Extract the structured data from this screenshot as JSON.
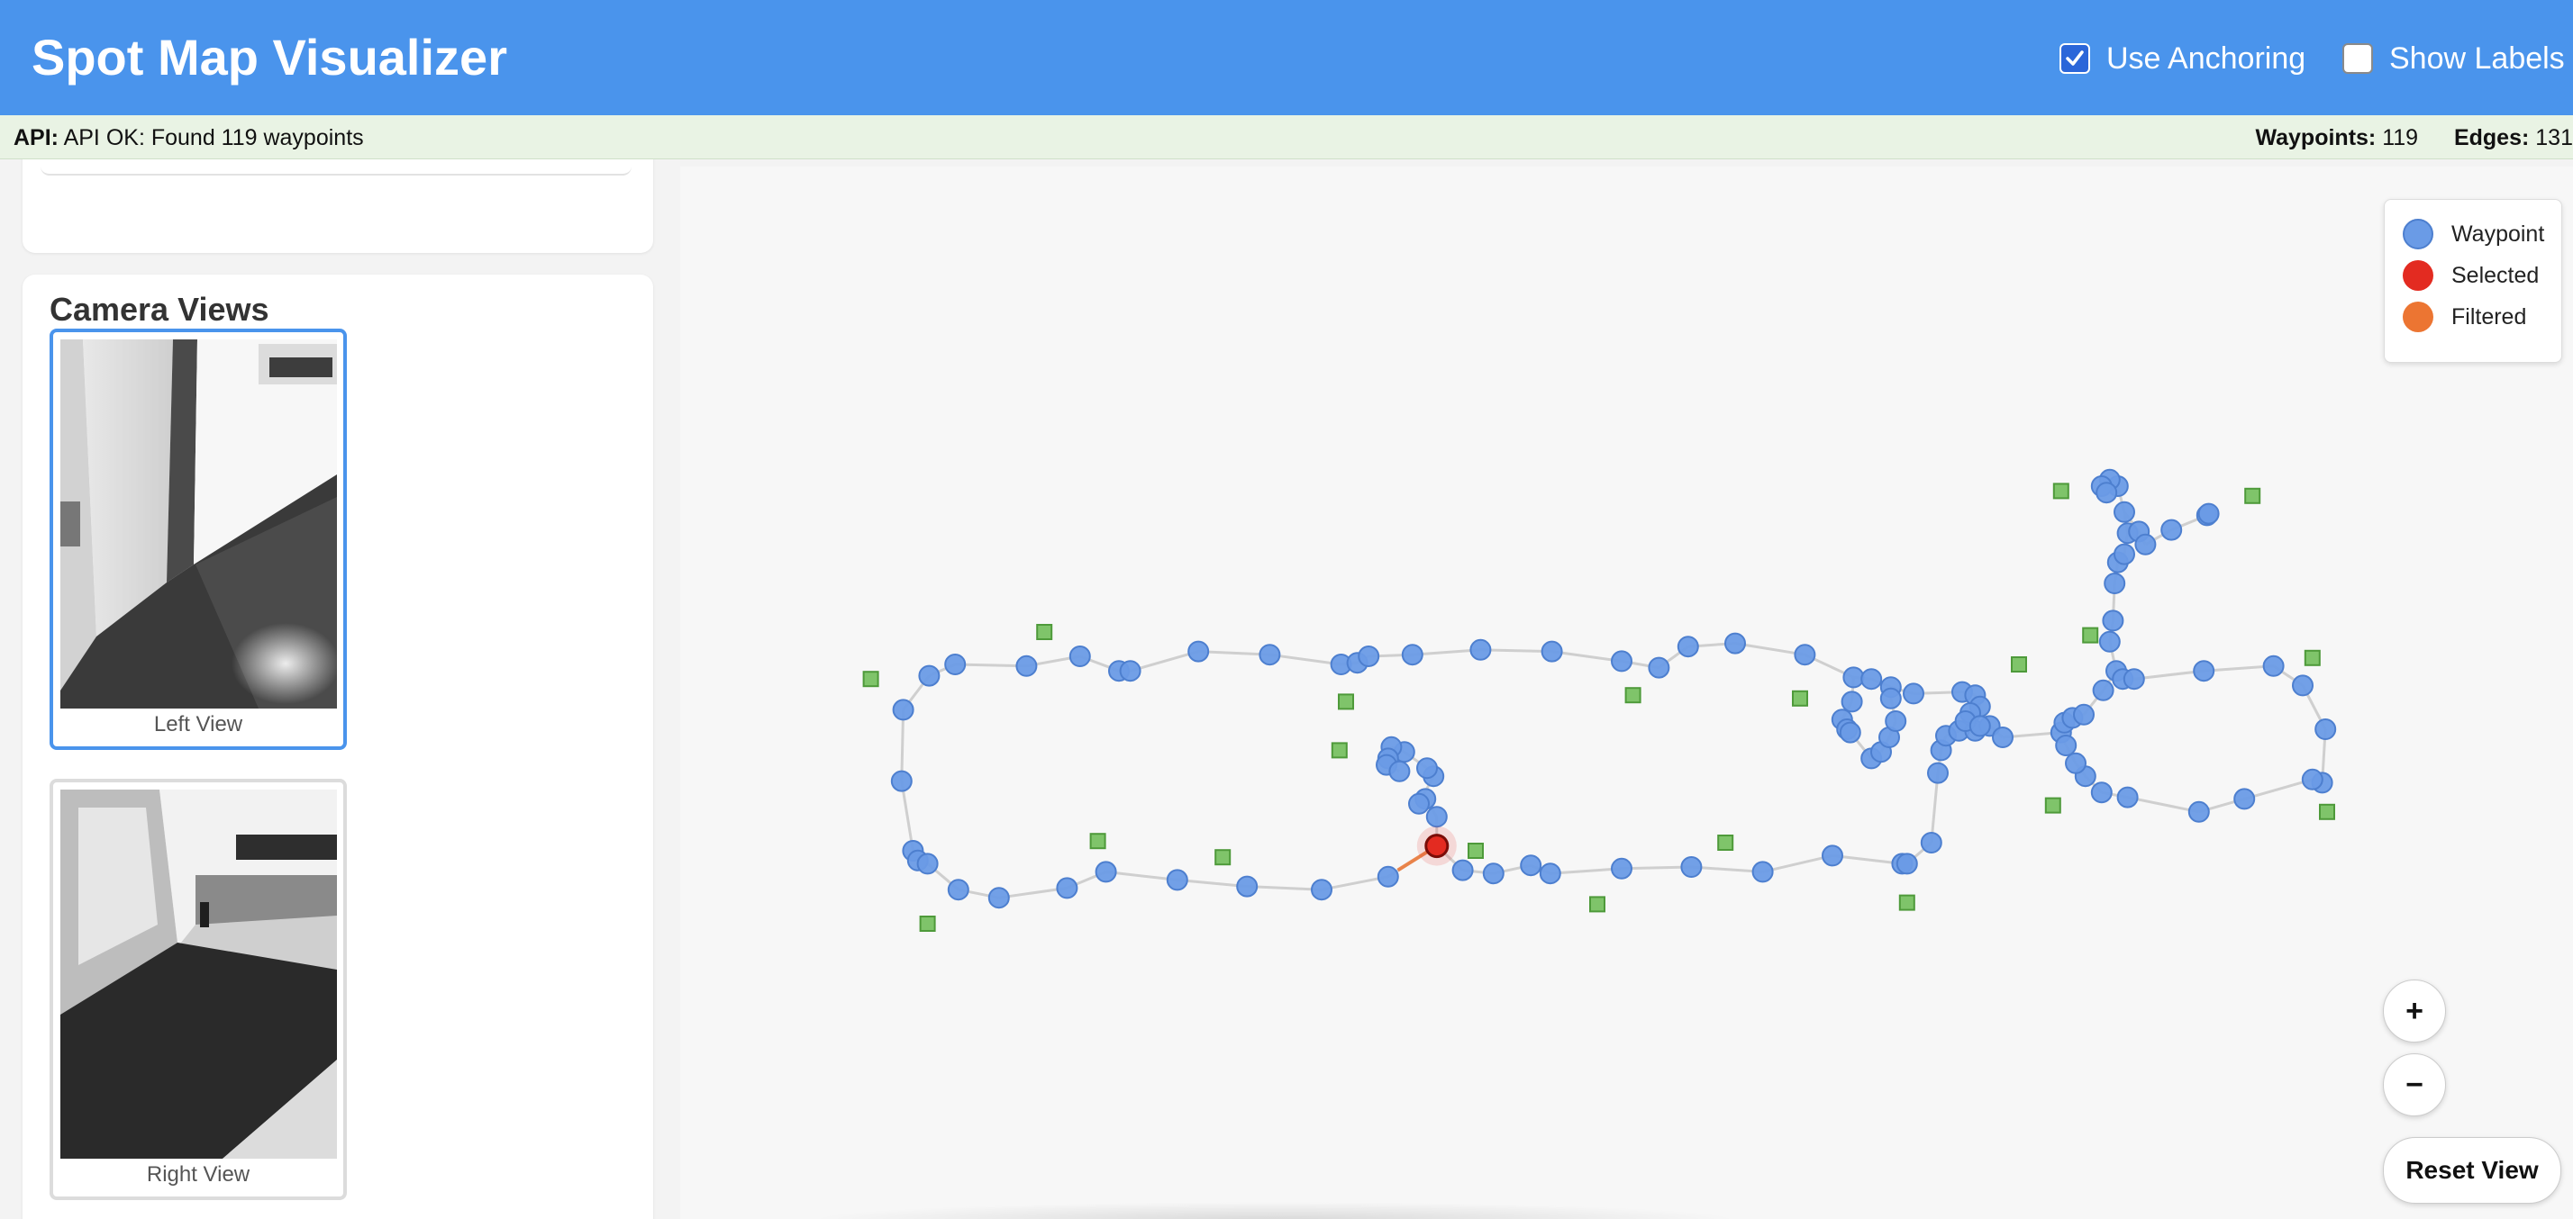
{
  "header": {
    "title": "Spot Map Visualizer",
    "use_anchoring": {
      "label": "Use Anchoring",
      "checked": true
    },
    "show_labels": {
      "label": "Show Labels",
      "checked": false
    }
  },
  "status": {
    "api_label": "API:",
    "api_message": "API OK: Found 119 waypoints",
    "waypoints_label": "Waypoints:",
    "waypoints_value": "119",
    "edges_label": "Edges:",
    "edges_value": "131"
  },
  "camera": {
    "title": "Camera Views",
    "views": [
      {
        "label": "Left View",
        "selected": true
      },
      {
        "label": "Right View",
        "selected": false
      }
    ]
  },
  "legend": {
    "waypoint": "Waypoint",
    "selected": "Selected",
    "filtered": "Filtered"
  },
  "controls": {
    "zoom_in": "+",
    "zoom_out": "−",
    "reset": "Reset View"
  },
  "colors": {
    "header": "#4a94ec",
    "waypoint": "#6a9be6",
    "selected": "#e32b21",
    "filtered": "#ec7532",
    "anchor": "#7fc46a"
  }
}
